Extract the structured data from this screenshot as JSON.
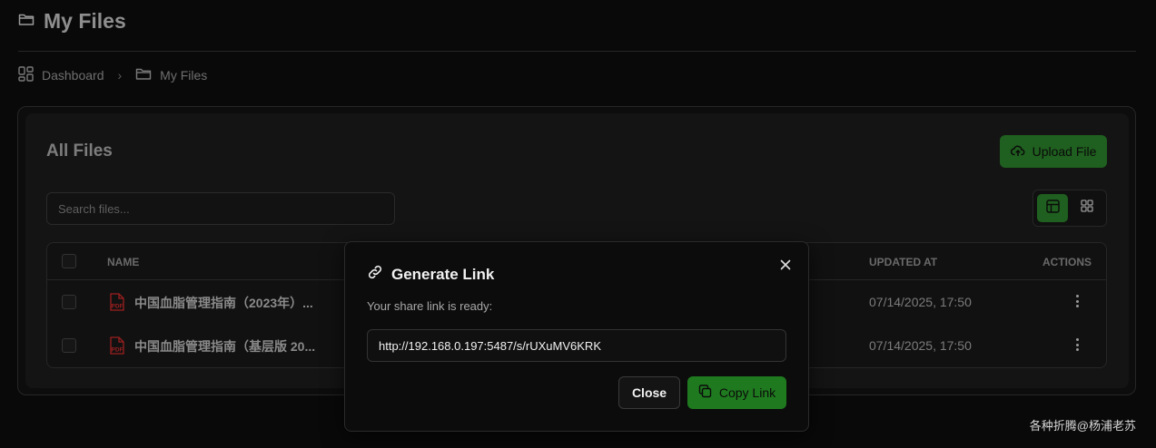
{
  "header": {
    "title": "My Files",
    "icon": "folder-icon"
  },
  "breadcrumb": {
    "items": [
      {
        "label": "Dashboard",
        "icon": "dashboard-icon"
      },
      {
        "label": "My Files",
        "icon": "folder-icon"
      }
    ]
  },
  "panel": {
    "title": "All Files",
    "upload_label": "Upload File",
    "search_placeholder": "Search files...",
    "view_mode": "table"
  },
  "table": {
    "columns": {
      "name": "NAME",
      "updated": "UPDATED AT",
      "actions": "ACTIONS"
    },
    "rows": [
      {
        "name": "中国血脂管理指南（2023年）...",
        "updated": "07/14/2025, 17:50",
        "type": "pdf"
      },
      {
        "name": "中国血脂管理指南（基层版 20...",
        "updated": "07/14/2025, 17:50",
        "type": "pdf"
      }
    ]
  },
  "modal": {
    "title": "Generate Link",
    "description": "Your share link is ready:",
    "link": "http://192.168.0.197:5487/s/rUXuMV6KRK",
    "close_label": "Close",
    "copy_label": "Copy Link"
  },
  "watermark": "各种折腾@杨浦老苏",
  "colors": {
    "accent": "#1f7a1f",
    "background": "#090909"
  }
}
